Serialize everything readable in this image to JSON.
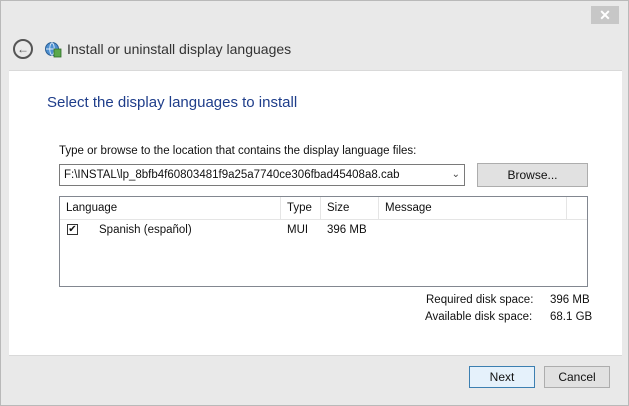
{
  "window": {
    "close_glyph": "✕",
    "title": "Install or uninstall display languages"
  },
  "icons": {
    "back": "back-arrow-icon",
    "app": "language-globe-icon",
    "checkmark": "checkmark-icon",
    "chevron": "chevron-down-icon"
  },
  "content": {
    "heading": "Select the display languages to install",
    "path_label": "Type or browse to the location that contains the display language files:",
    "path_value": "F:\\INSTAL\\lp_8bfb4f60803481f9a25a7740ce306fbad45408a8.cab",
    "browse_label": "Browse...",
    "columns": [
      "Language",
      "Type",
      "Size",
      "Message"
    ],
    "rows": [
      {
        "checked": true,
        "language": "Spanish (español)",
        "type": "MUI",
        "size": "396 MB",
        "message": ""
      }
    ],
    "required_label": "Required disk space:",
    "required_value": "396 MB",
    "available_label": "Available disk space:",
    "available_value": "68.1 GB"
  },
  "footer": {
    "next_label": "Next",
    "cancel_label": "Cancel"
  },
  "colors": {
    "heading": "#1e3d8a",
    "accent_border": "#3c7fb1"
  }
}
